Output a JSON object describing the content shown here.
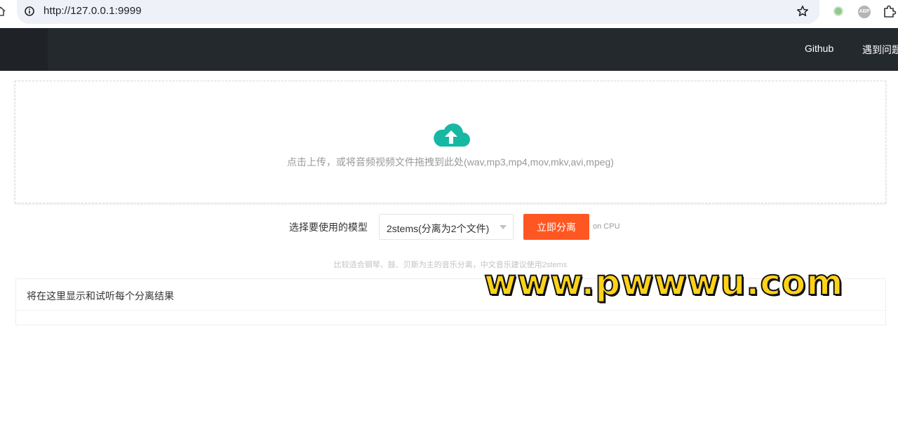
{
  "browser": {
    "url": "http://127.0.0.1:9999",
    "extension_abp_label": "ABP",
    "icons": [
      "home-icon",
      "info-icon",
      "star-icon",
      "extension-icon",
      "abp-icon",
      "puzzle-icon"
    ]
  },
  "header": {
    "nav": {
      "github": "Github",
      "help": "遇到问题"
    },
    "background_color": "#24292e"
  },
  "upload": {
    "hint": "点击上传，或将音频视频文件拖拽到此处(wav,mp3,mp4,mov,mkv,avi,mpeg)",
    "icon": "cloud-upload-icon",
    "icon_color": "#16b8a4"
  },
  "controls": {
    "model_label": "选择要使用的模型",
    "model_selected": "2stems(分离为2个文件)",
    "separate_button": "立即分离",
    "device_text": "on CPU",
    "model_hint": "比较适合钢琴、鼓、贝斯为主的音乐分离，中文音乐建议使用2stems",
    "button_color": "#ff5722"
  },
  "results": {
    "title": "将在这里显示和试听每个分离结果"
  },
  "watermark": {
    "text": "www.pwwwu.com"
  }
}
